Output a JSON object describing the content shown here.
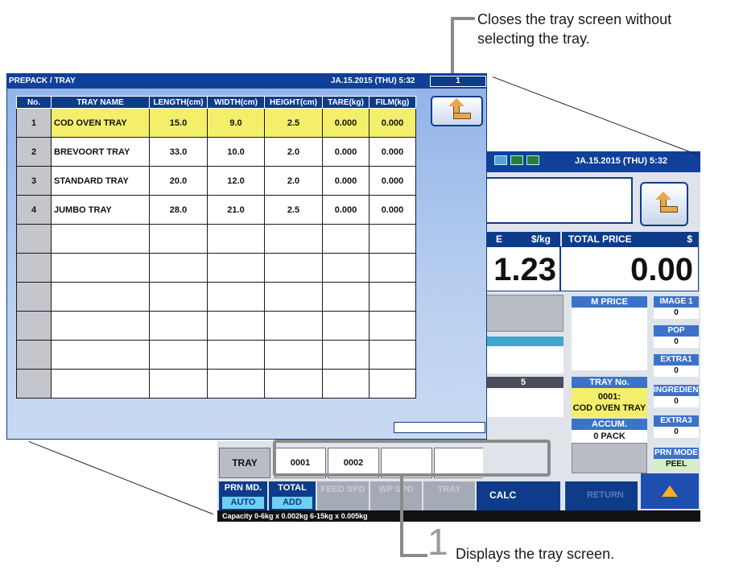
{
  "callouts": {
    "close_line1": "Closes the tray screen without",
    "close_line2": "selecting the tray.",
    "step_number": "1",
    "step_text": "Displays the tray screen."
  },
  "tray_screen": {
    "title": "PREPACK / TRAY",
    "datetime": "JA.15.2015 (THU)  5:32",
    "status_box": "1",
    "columns": [
      "No.",
      "TRAY NAME",
      "LENGTH(cm)",
      "WIDTH(cm)",
      "HEIGHT(cm)",
      "TARE(kg)",
      "FILM(kg)"
    ],
    "rows": [
      {
        "no": "1",
        "name": "COD OVEN TRAY",
        "length": "15.0",
        "width": "9.0",
        "height": "2.5",
        "tare": "0.000",
        "film": "0.000"
      },
      {
        "no": "2",
        "name": "BREVOORT TRAY",
        "length": "33.0",
        "width": "10.0",
        "height": "2.0",
        "tare": "0.000",
        "film": "0.000"
      },
      {
        "no": "3",
        "name": "STANDARD TRAY",
        "length": "20.0",
        "width": "12.0",
        "height": "2.0",
        "tare": "0.000",
        "film": "0.000"
      },
      {
        "no": "4",
        "name": "JUMBO TRAY",
        "length": "28.0",
        "width": "21.0",
        "height": "2.5",
        "tare": "0.000",
        "film": "0.000"
      }
    ],
    "selected_row": 0,
    "return_icon": "return-arrow-icon"
  },
  "main_screen": {
    "datetime": "JA.15.2015 (THU)  5:32",
    "unit_label_left": "E",
    "unit_label": "$/kg",
    "total_price_label": "TOTAL PRICE",
    "total_price_unit": "$",
    "unit_price_value": "1.23",
    "total_price_value": "0.00",
    "m_price_label": "M PRICE",
    "col5_label": "5",
    "tray_no_label": "TRAY No.",
    "tray_no_value_line1": "0001:",
    "tray_no_value_line2": "COD OVEN TRAY",
    "accum_label": "ACCUM.",
    "accum_value": "0 PACK",
    "side": [
      {
        "label": "IMAGE 1",
        "value": "0"
      },
      {
        "label": "POP",
        "value": "0"
      },
      {
        "label": "EXTRA1",
        "value": "0"
      },
      {
        "label": "INGREDIENT",
        "value": "0"
      },
      {
        "label": "EXTRA3",
        "value": "0"
      },
      {
        "label": "PRN MODE",
        "value": "PEEL"
      }
    ]
  },
  "bottom_strip": {
    "tray_button": "TRAY",
    "slots": [
      "0001",
      "0002",
      "",
      "",
      ""
    ],
    "prn_md_label": "PRN MD.",
    "prn_md_value": "AUTO",
    "total_label": "TOTAL",
    "total_value": "ADD",
    "feed_spd": "FEED SPD",
    "wp_spd": "WP SPD",
    "tray_disabled": "TRAY",
    "calc": "CALC",
    "return_label": "RETURN",
    "capacity": "Capacity 0-6kg x 0.002kg  6-15kg x 0.005kg"
  },
  "colors": {
    "header_blue": "#0e3c8a",
    "selected_yellow": "#f4ef6a",
    "accent_cyan": "#6fd0f0"
  }
}
